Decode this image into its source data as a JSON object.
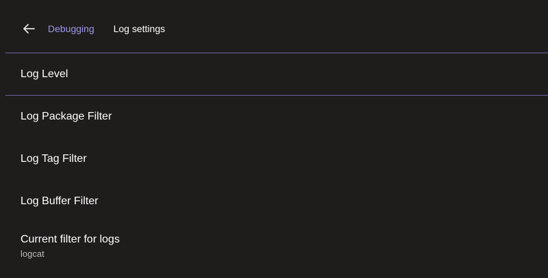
{
  "header": {
    "back_icon": "arrow-left-icon",
    "parent": "Debugging",
    "title": "Log settings"
  },
  "items": [
    {
      "title": "Log Level"
    },
    {
      "title": "Log Package Filter"
    },
    {
      "title": "Log Tag Filter"
    },
    {
      "title": "Log Buffer Filter"
    },
    {
      "title": "Current filter for logs",
      "summary": "logcat"
    }
  ],
  "colors": {
    "background": "#1f1c1c",
    "accent": "#9f98e8",
    "focus_line": "#6a64a8"
  }
}
